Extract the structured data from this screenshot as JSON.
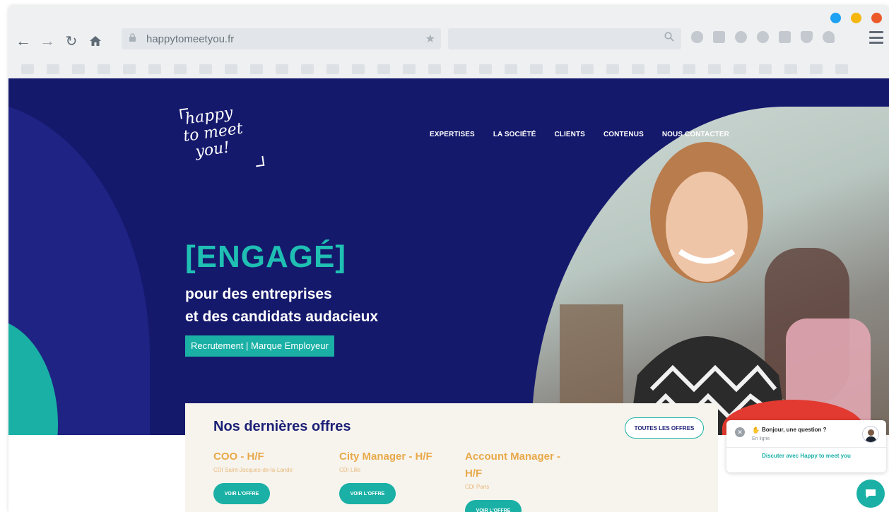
{
  "browser": {
    "url": "happytomeetyou.fr",
    "window_dot_colors": [
      "#1da1f2",
      "#f5b70e",
      "#ec5a2a"
    ]
  },
  "site": {
    "logo_text": [
      "happy",
      "to meet",
      "you!"
    ],
    "nav": [
      "EXPERTISES",
      "LA SOCIÉTÉ",
      "CLIENTS",
      "CONTENUS",
      "NOUS CONTACTER"
    ],
    "hero": {
      "tagline": "[ENGAGÉ]",
      "subtitle_line1": "pour des entreprises",
      "subtitle_line2": "et des candidats audacieux",
      "cta": "Recrutement | Marque Employeur"
    },
    "offers": {
      "title": "Nos dernières offres",
      "all_button": "TOUTES LES OFFRES",
      "jobs": [
        {
          "title": "COO - H/F",
          "meta": "CDI Saint-Jacques-de-la-Lande",
          "button": "VOIR L'OFFRE"
        },
        {
          "title": "City Manager - H/F",
          "meta": "CDI Lille",
          "button": "VOIR L'OFFRE"
        },
        {
          "title": "Account Manager - H/F",
          "meta": "CDI Paris",
          "button": "VOIR L'OFFRE"
        }
      ]
    },
    "chat": {
      "message": "Bonjour, une question ?",
      "status": "En ligne",
      "action": "Discuter avec Happy to meet you"
    }
  },
  "colors": {
    "navy": "#15196c",
    "teal": "#1ab0a5",
    "orange": "#e8a94a"
  }
}
